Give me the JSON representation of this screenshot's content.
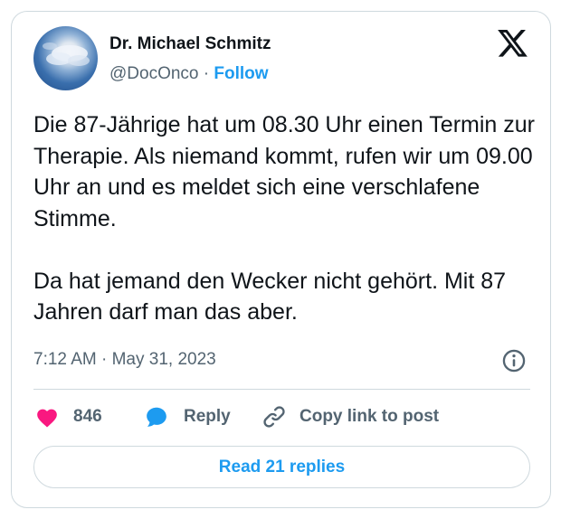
{
  "author": {
    "name": "Dr. Michael Schmitz",
    "handle": "@DocOnco",
    "separator": "·",
    "follow_label": "Follow"
  },
  "tweet": {
    "paragraphs": [
      "Die 87-Jährige hat um 08.30 Uhr einen Termin zur Therapie. Als niemand kommt, rufen wir um 09.00 Uhr an und es meldet sich eine verschlafene Stimme.",
      "Da hat jemand den Wecker nicht gehört. Mit 87 Jahren darf man das aber."
    ],
    "timestamp": "7:12 AM · May 31, 2023"
  },
  "actions": {
    "like_count": "846",
    "reply_label": "Reply",
    "copy_label": "Copy link to post"
  },
  "read_replies_label": "Read 21 replies",
  "icons": {
    "platform": "x-logo-icon",
    "info": "info-icon",
    "like": "heart-icon",
    "reply": "speech-bubble-icon",
    "copy": "link-icon"
  },
  "colors": {
    "accent": "#1d9bf0",
    "heart": "#f91880",
    "text": "#0f1419",
    "secondary": "#536471",
    "border": "#cfd9de"
  }
}
